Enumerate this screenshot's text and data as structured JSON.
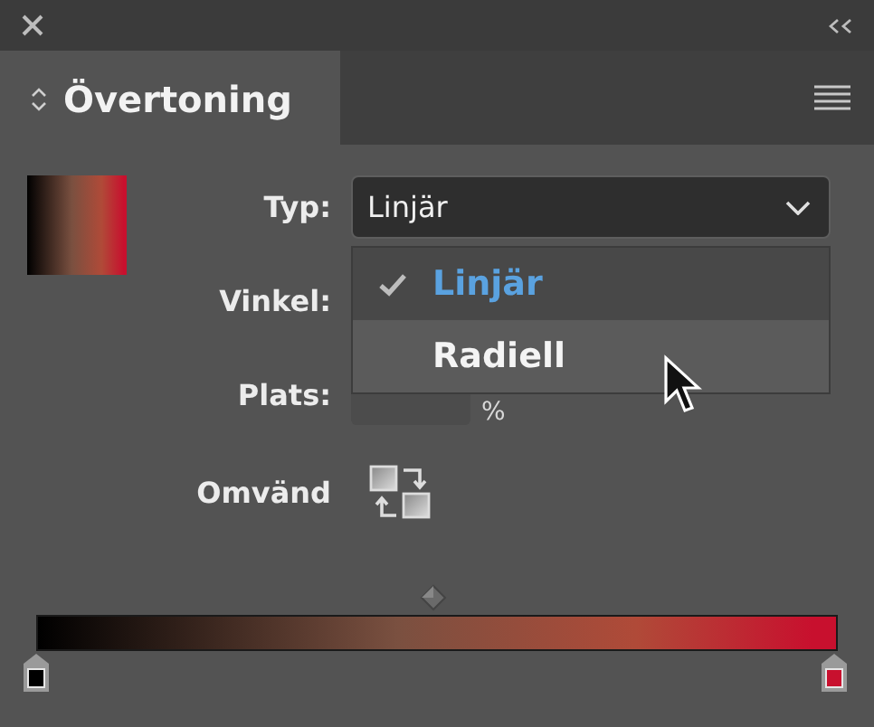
{
  "panel": {
    "tab_label": "Övertoning"
  },
  "type_label": "Typ:",
  "type_value": "Linjär",
  "type_options": [
    {
      "label": "Linjär",
      "selected": true,
      "highlighted": false
    },
    {
      "label": "Radiell",
      "selected": false,
      "highlighted": true
    }
  ],
  "angle_label": "Vinkel:",
  "location_label": "Plats:",
  "location_unit": "%",
  "reverse_label": "Omvänd",
  "gradient_stops": [
    {
      "color": "#000000"
    },
    {
      "color": "#c8102e"
    }
  ]
}
